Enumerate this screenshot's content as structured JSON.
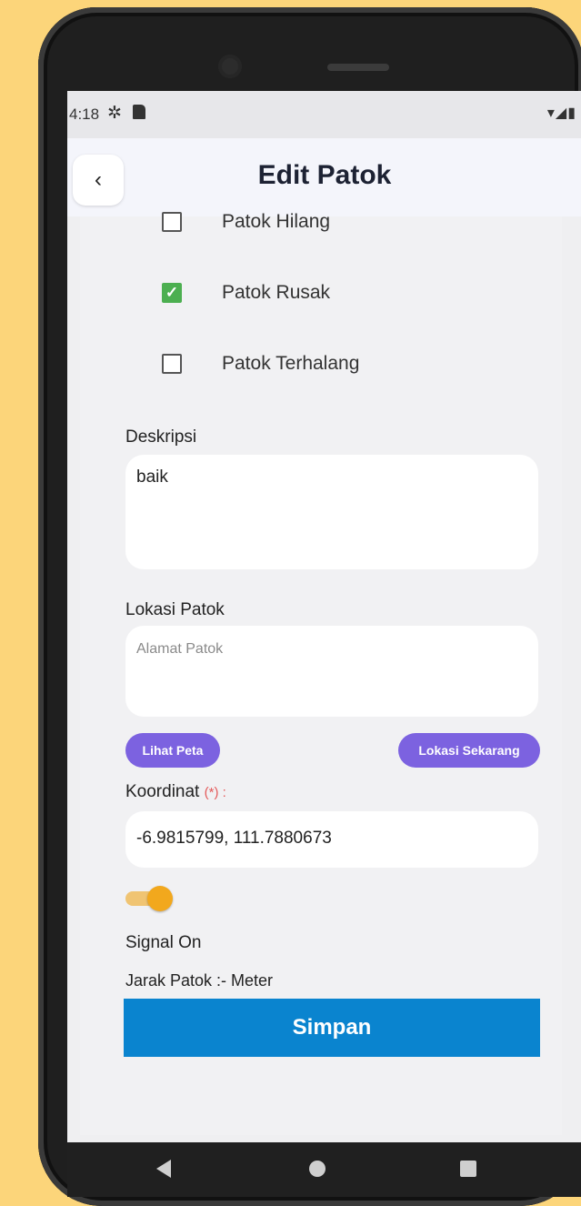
{
  "status": {
    "time": "4:18",
    "icons": [
      "gear-icon",
      "sd-card-icon",
      "wifi-icon",
      "signal-icon",
      "battery-icon"
    ]
  },
  "appbar": {
    "title": "Edit Patok",
    "back_glyph": "‹"
  },
  "checkboxes": [
    {
      "label": "Patok Hilang",
      "checked": false
    },
    {
      "label": "Patok Rusak",
      "checked": true
    },
    {
      "label": "Patok Terhalang",
      "checked": false
    }
  ],
  "deskripsi": {
    "label": "Deskripsi",
    "value": "baik"
  },
  "lokasi": {
    "label": "Lokasi Patok",
    "placeholder": "Alamat Patok"
  },
  "buttons": {
    "lihat_peta": "Lihat Peta",
    "lokasi_sekarang": "Lokasi Sekarang",
    "simpan": "Simpan"
  },
  "koordinat": {
    "label": "Koordinat",
    "required": "(*) :",
    "value": "-6.9815799, 111.7880673"
  },
  "signal": {
    "on": true,
    "label": "Signal On"
  },
  "jarak": {
    "label": "Jarak Patok :- Meter"
  },
  "colors": {
    "accent": "#7c62e0",
    "primary": "#0a84cf",
    "toggle": "#f2a81d",
    "check": "#4caf50"
  }
}
